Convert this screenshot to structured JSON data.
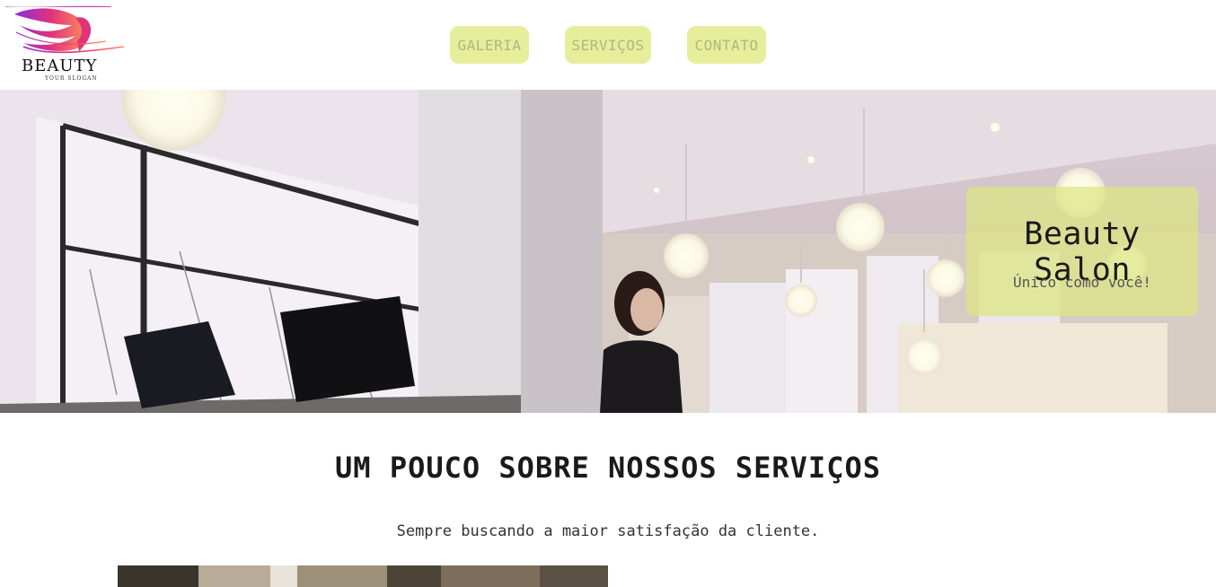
{
  "logo": {
    "word": "BEAUTY",
    "slogan": "YOUR SLOGAN"
  },
  "nav": {
    "items": [
      "GALERIA",
      "SERVIÇOS",
      "CONTATO"
    ]
  },
  "hero": {
    "title": "Beauty Salon",
    "subtitle": "Único como você!"
  },
  "about": {
    "title": "UM POUCO SOBRE NOSSOS SERVIÇOS",
    "subtitle": "Sempre buscando a maior satisfação da cliente."
  },
  "colors": {
    "nav_bg": "#e6ee9c",
    "nav_text": "#b0b780",
    "card_bg": "#dde682",
    "logo_pink": "#e0337a",
    "logo_purple": "#8a2be2"
  }
}
